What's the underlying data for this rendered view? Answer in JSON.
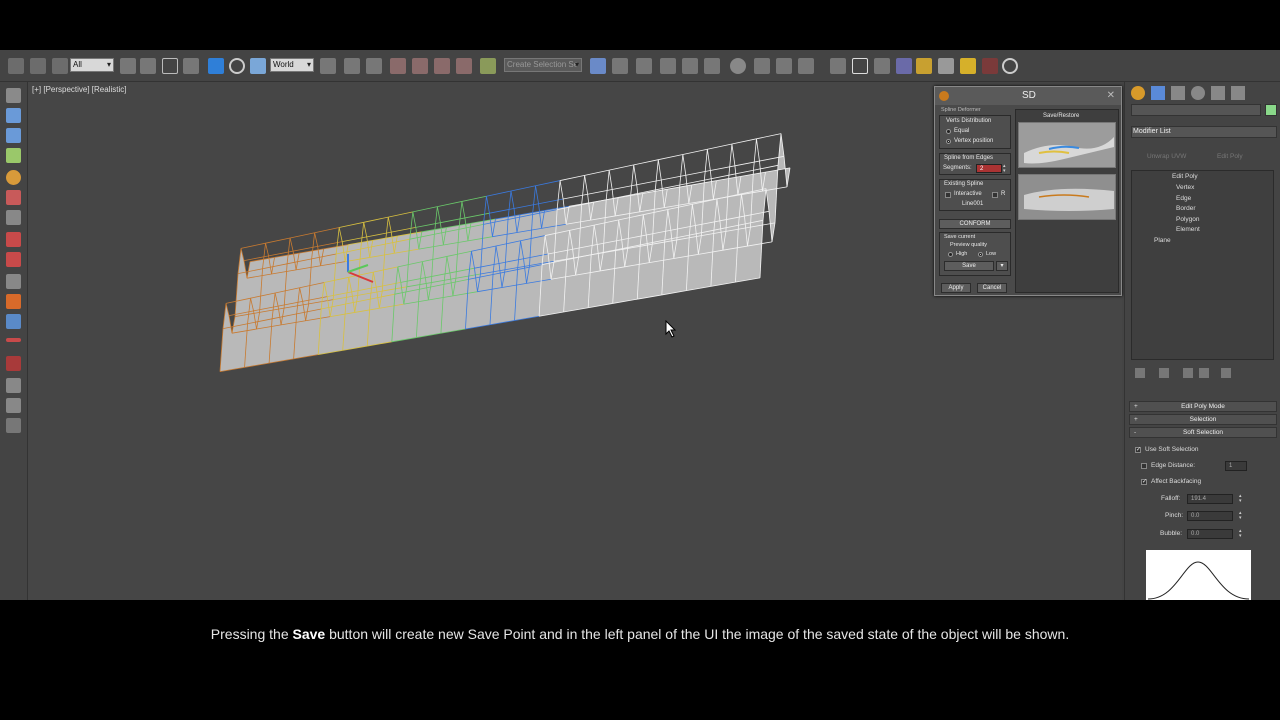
{
  "toolbar": {
    "filter_select": "All",
    "ref_coord_select": "World",
    "selection_set_select": "Create Selection Se"
  },
  "viewport": {
    "label": "[+] [Perspective] [Realistic]"
  },
  "sd_panel": {
    "title": "SD",
    "section_title": "Spline Deformer",
    "verts_distribution_label": "Verts Distribution",
    "option_equal": "Equal",
    "option_vertex_position": "Vertex position",
    "spline_from_edges_label": "Spline from Edges",
    "segments_label": "Segments:",
    "segments_value": "2",
    "existing_spline_label": "Existing Spline",
    "interactive_label": "Interactive",
    "r_label": "R",
    "spline_name": "Line001",
    "conform_button": "CONFORM",
    "save_current_label": "Save current",
    "preview_quality_label": "Preview quality",
    "option_high": "High",
    "option_low": "Low",
    "save_button": "Save",
    "apply_button": "Apply",
    "cancel_button": "Cancel",
    "save_restore_label": "Save/Restore"
  },
  "command_panel": {
    "modifier_list_label": "Modifier List",
    "unwrap_uvw_button": "Unwrap UVW",
    "edit_poly_button": "Edit Poly",
    "stack_items": [
      "Edit Poly",
      "Vertex",
      "Edge",
      "Border",
      "Polygon",
      "Element",
      "Plane"
    ],
    "rollout_edit_poly_mode": "Edit Poly Mode",
    "rollout_selection": "Selection",
    "rollout_soft_selection": "Soft Selection",
    "use_soft_selection": "Use Soft Selection",
    "edge_distance": "Edge Distance:",
    "edge_distance_value": "1",
    "affect_backfacing": "Affect Backfacing",
    "falloff_label": "Falloff:",
    "falloff_value": "191.4",
    "pinch_label": "Pinch:",
    "pinch_value": "0.0",
    "bubble_label": "Bubble:",
    "bubble_value": "0.0"
  },
  "caption": {
    "before": "Pressing the ",
    "bold": "Save",
    "after": " button will create new Save Point and in the left panel of the UI the image of the saved state of the object will be shown."
  },
  "colors": {
    "ui_bg": "#444444",
    "viewport_bg": "#464646",
    "accent_blue": "#2f7fd8",
    "accent_orange": "#d6861d"
  }
}
